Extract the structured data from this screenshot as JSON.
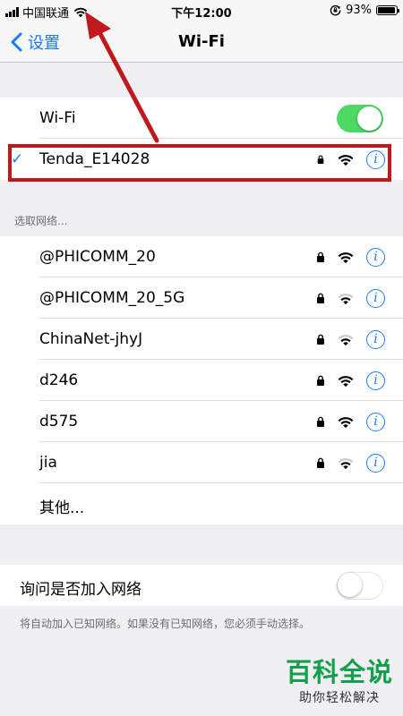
{
  "status_bar": {
    "carrier": "中国联通",
    "time": "下午12:00",
    "battery": "93%",
    "battery_level": 0.93
  },
  "nav": {
    "back_label": "设置",
    "title": "Wi-Fi"
  },
  "wifi_toggle": {
    "label": "Wi-Fi",
    "state": "on"
  },
  "connected_network": {
    "name": "Tenda_E14028",
    "secured": true,
    "signal": 3
  },
  "choose_network_header": "选取网络...",
  "networks": [
    {
      "name": "@PHICOMM_20",
      "secured": true,
      "signal": 3
    },
    {
      "name": "@PHICOMM_20_5G",
      "secured": true,
      "signal": 2
    },
    {
      "name": "ChinaNet-jhyJ",
      "secured": true,
      "signal": 2
    },
    {
      "name": "d246",
      "secured": true,
      "signal": 3
    },
    {
      "name": "d575",
      "secured": true,
      "signal": 3
    },
    {
      "name": "jia",
      "secured": true,
      "signal": 2
    }
  ],
  "other_label": "其他...",
  "ask_to_join": {
    "label": "询问是否加入网络",
    "state": "off"
  },
  "ask_footer": "将自动加入已知网络。如果没有已知网络，您必须手动选择。",
  "watermark": {
    "title": "百科全说",
    "subtitle": "助你轻松解决"
  },
  "colors": {
    "accent": "#1a7cf4",
    "toggle_on": "#4cd964",
    "annotation": "#c0181b",
    "watermark_green": "#14a04a"
  }
}
